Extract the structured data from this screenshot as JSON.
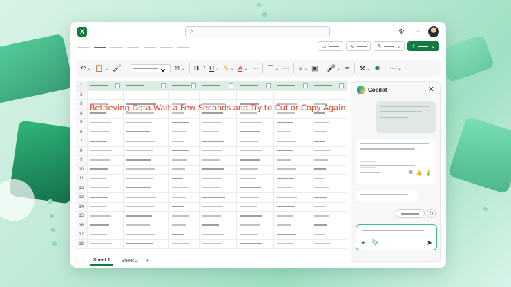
{
  "window": {
    "app_icon_letter": "X",
    "search_icon": "search-icon",
    "settings_icon": "gear-icon",
    "more_icon": "ellipsis-icon"
  },
  "ribbon": {
    "font_size": "11",
    "bold": "B",
    "italic": "I",
    "underline": "U",
    "font_color": "A"
  },
  "error_message": "Retrieving Data Wait a Few Seconds and Try to Cut or Copy Again",
  "grid": {
    "row_numbers": [
      "1",
      "2",
      "3",
      "4",
      "5",
      "6",
      "7",
      "8",
      "9",
      "10",
      "11",
      "12",
      "13",
      "14",
      "15",
      "16",
      "17",
      "18"
    ]
  },
  "sheets": [
    {
      "label": "Sheet 1",
      "active": true
    },
    {
      "label": "Sheet 2",
      "active": false
    }
  ],
  "sheet_nav": {
    "prev": "‹",
    "next": "›",
    "add": "+"
  },
  "copilot": {
    "title": "Copilot",
    "close": "✕"
  },
  "colors": {
    "accent": "#107c41",
    "error": "#e8452c",
    "header_fill": "#dceee4"
  }
}
